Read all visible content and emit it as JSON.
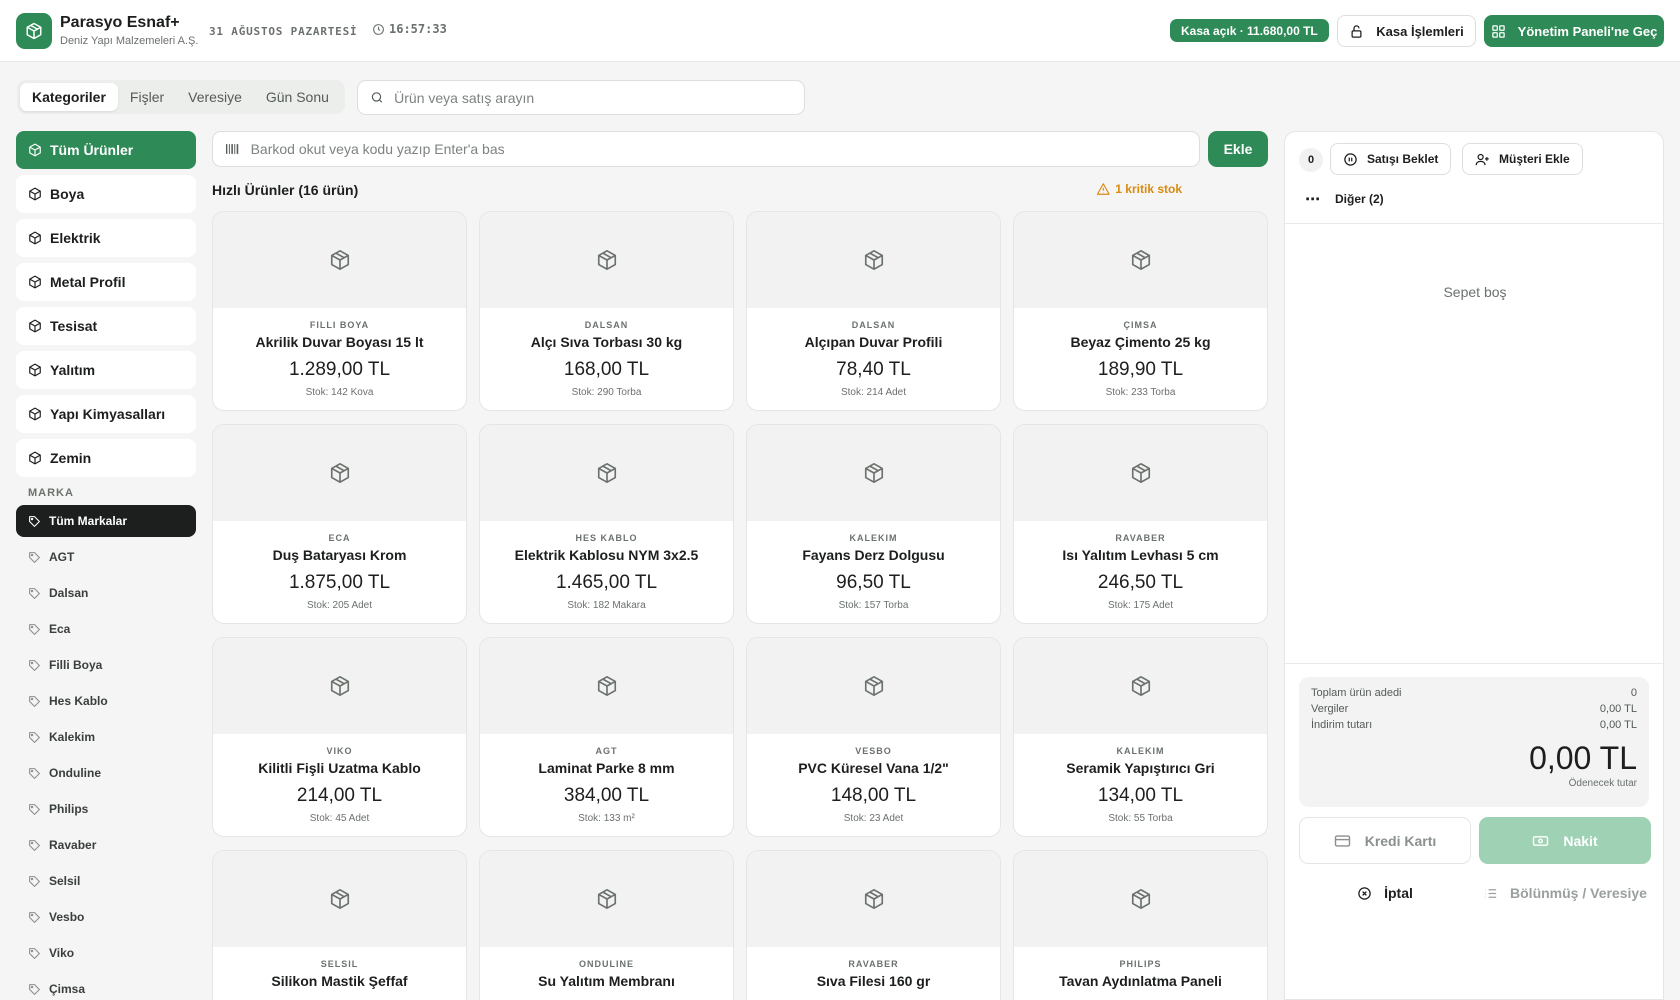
{
  "header": {
    "app_name": "Parasyo Esnaf+",
    "company": "Deniz Yapı Malzemeleri A.Ş.",
    "date": "31 AĞUSTOS PAZARTESİ",
    "time": "16:57:33",
    "kasa_status": "Kasa açık · 11.680,00 TL",
    "kasa_button": "Kasa İşlemleri",
    "admin_button": "Yönetim Paneli'ne Geç"
  },
  "tabs": [
    "Kategoriler",
    "Fişler",
    "Veresiye",
    "Gün Sonu"
  ],
  "search": {
    "placeholder": "Ürün veya satış arayın"
  },
  "categories": [
    "Tüm Ürünler",
    "Boya",
    "Elektrik",
    "Metal Profil",
    "Tesisat",
    "Yalıtım",
    "Yapı Kimyasalları",
    "Zemin"
  ],
  "brands_label": "MARKA",
  "brands": [
    "Tüm Markalar",
    "AGT",
    "Dalsan",
    "Eca",
    "Filli Boya",
    "Hes Kablo",
    "Kalekim",
    "Onduline",
    "Philips",
    "Ravaber",
    "Selsil",
    "Vesbo",
    "Viko",
    "Çimsa"
  ],
  "barcode": {
    "placeholder": "Barkod okut veya kodu yazıp Enter'a bas",
    "add_label": "Ekle"
  },
  "quick_title": "Hızlı Ürünler (16 ürün)",
  "critical_stock": "1 kritik stok",
  "products": [
    {
      "brand": "Filli Boya",
      "name": "Akrilik Duvar Boyası 15 lt",
      "price": "1.289,00 TL",
      "stock": "Stok: 142 Kova"
    },
    {
      "brand": "Dalsan",
      "name": "Alçı Sıva Torbası 30 kg",
      "price": "168,00 TL",
      "stock": "Stok: 290 Torba"
    },
    {
      "brand": "Dalsan",
      "name": "Alçıpan Duvar Profili",
      "price": "78,40 TL",
      "stock": "Stok: 214 Adet"
    },
    {
      "brand": "Çimsa",
      "name": "Beyaz Çimento 25 kg",
      "price": "189,90 TL",
      "stock": "Stok: 233 Torba"
    },
    {
      "brand": "Eca",
      "name": "Duş Bataryası Krom",
      "price": "1.875,00 TL",
      "stock": "Stok: 205 Adet"
    },
    {
      "brand": "Hes Kablo",
      "name": "Elektrik Kablosu NYM 3x2.5",
      "price": "1.465,00 TL",
      "stock": "Stok: 182 Makara"
    },
    {
      "brand": "Kalekim",
      "name": "Fayans Derz Dolgusu",
      "price": "96,50 TL",
      "stock": "Stok: 157 Torba"
    },
    {
      "brand": "Ravaber",
      "name": "Isı Yalıtım Levhası 5 cm",
      "price": "246,50 TL",
      "stock": "Stok: 175 Adet"
    },
    {
      "brand": "Viko",
      "name": "Kilitli Fişli Uzatma Kablo",
      "price": "214,00 TL",
      "stock": "Stok: 45 Adet"
    },
    {
      "brand": "AGT",
      "name": "Laminat Parke 8 mm",
      "price": "384,00 TL",
      "stock": "Stok: 133 m²"
    },
    {
      "brand": "Vesbo",
      "name": "PVC Küresel Vana 1/2\"",
      "price": "148,00 TL",
      "stock": "Stok: 23 Adet"
    },
    {
      "brand": "Kalekim",
      "name": "Seramik Yapıştırıcı Gri",
      "price": "134,00 TL",
      "stock": "Stok: 55 Torba"
    },
    {
      "brand": "Selsil",
      "name": "Silikon Mastik Şeffaf",
      "price": "",
      "stock": ""
    },
    {
      "brand": "Onduline",
      "name": "Su Yalıtım Membranı",
      "price": "",
      "stock": ""
    },
    {
      "brand": "Ravaber",
      "name": "Sıva Filesi 160 gr",
      "price": "",
      "stock": ""
    },
    {
      "brand": "Philips",
      "name": "Tavan Aydınlatma Paneli",
      "price": "",
      "stock": ""
    }
  ],
  "cart": {
    "count": "0",
    "hold_button": "Satışı Beklet",
    "customer_button": "Müşteri Ekle",
    "more_button": "Diğer (2)",
    "empty_text": "Sepet boş",
    "total_items_label": "Toplam ürün adedi",
    "total_items_value": "0",
    "tax_label": "Vergiler",
    "tax_value": "0,00 TL",
    "discount_label": "İndirim tutarı",
    "discount_value": "0,00 TL",
    "grand_total": "0,00 TL",
    "grand_total_label": "Ödenecek tutar",
    "card_button": "Kredi Kartı",
    "cash_button": "Nakit",
    "cancel_button": "İptal",
    "split_button": "Bölünmüş / Veresiye"
  },
  "colors": {
    "accent": "#2e8b57",
    "accent_light": "#9fd1b4",
    "warning": "#d98a10",
    "dark": "#1c1f1d"
  }
}
